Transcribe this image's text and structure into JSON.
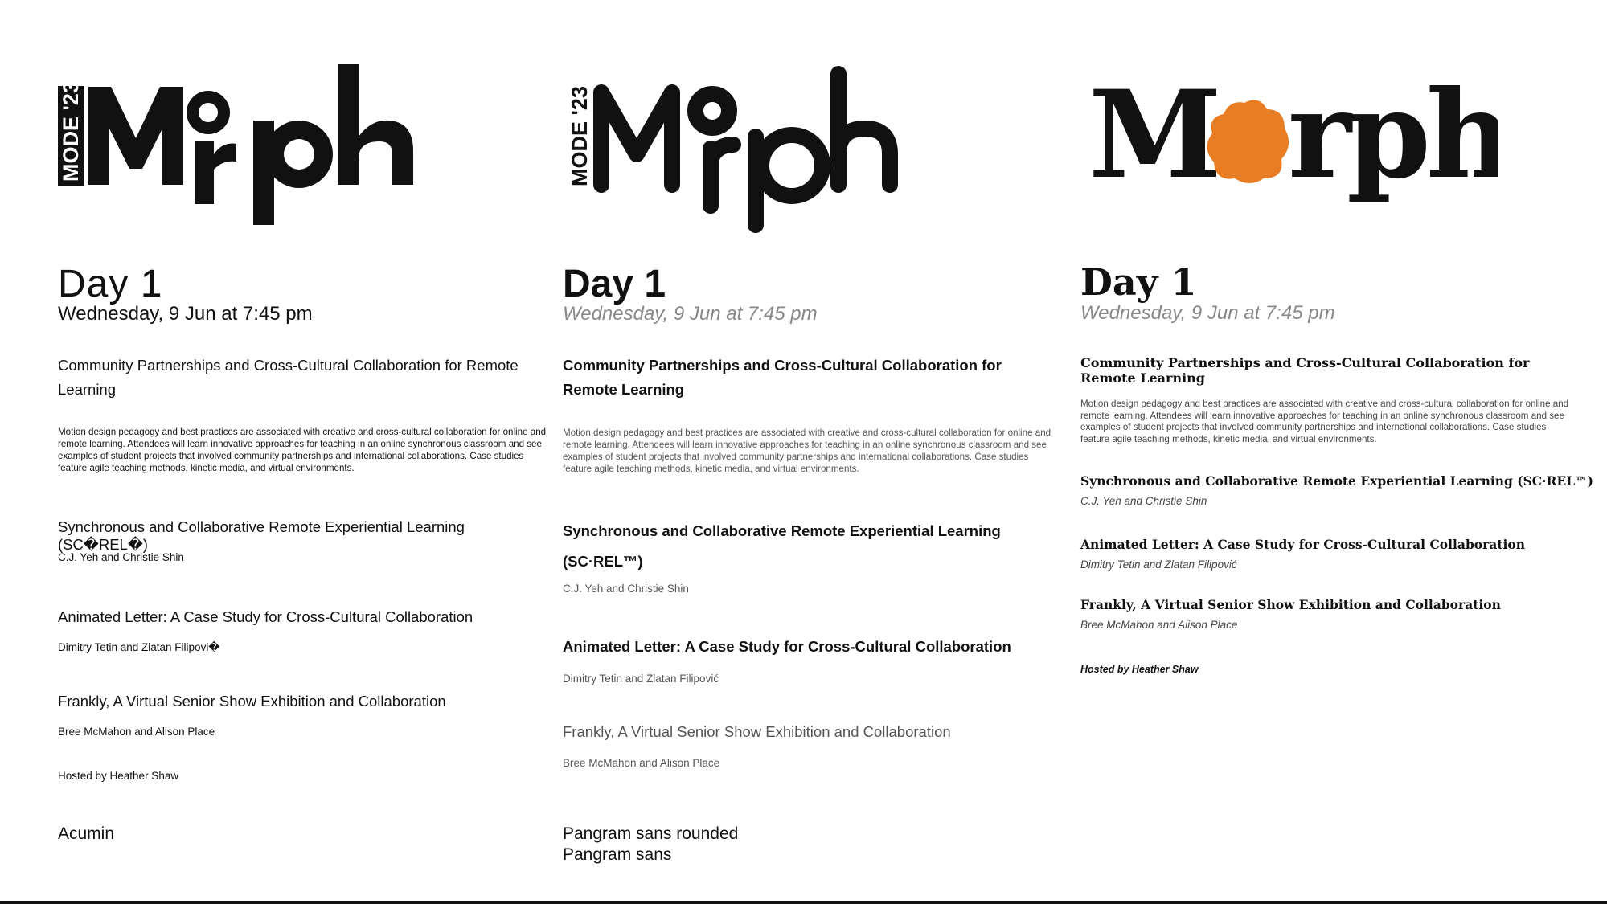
{
  "logos": {
    "word": "Morph",
    "tag": "MODE '23",
    "orange": "#e97d23"
  },
  "day": "Day  1",
  "date": "Wednesday, 9 Jun at 7:45 pm",
  "session_title": "Community Partnerships and Cross-Cultural Collaboration for Remote Learning",
  "description": "Motion design pedagogy and best practices are associated with creative and cross-cultural collaboration for online and remote learning. Attendees will learn innovative approaches for teaching in an online synchronous classroom and see examples of student projects that involved community partnerships and international collaborations. Case studies feature agile teaching methods, kinetic media, and virtual environments.",
  "talks": [
    {
      "title": "Synchronous and Collaborative Remote Experiential Learning (SC·REL™)",
      "authors": "C.J. Yeh and Christie Shin"
    },
    {
      "title": "Animated Letter: A Case Study for Cross-Cultural Collaboration",
      "authors": "Dimitry Tetin and Zlatan Filipović"
    },
    {
      "title": "Frankly, A Virtual Senior Show Exhibition and Collaboration",
      "authors": "Bree McMahon and Alison Place"
    }
  ],
  "hosted_by": "Hosted by Heather Shaw",
  "columns": {
    "col1": {
      "talk1_title": "Synchronous and Collaborative Remote Experiential Learning (SC�REL�)",
      "talk2_authors": "Dimitry Tetin and Zlatan Filipovi�",
      "font_label": "Acumin"
    },
    "col2": {
      "font_label_1": "Pangram sans rounded",
      "font_label_2": "Pangram sans"
    }
  }
}
